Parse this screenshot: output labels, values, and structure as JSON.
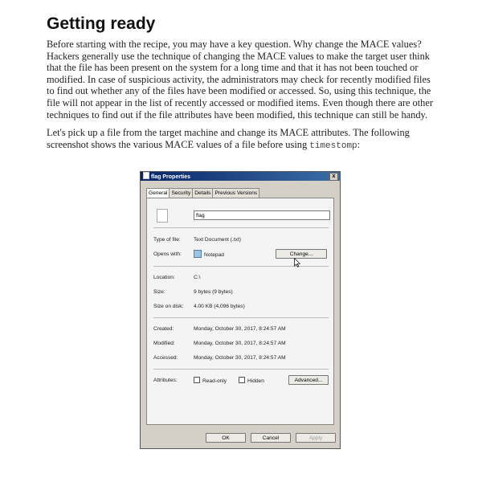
{
  "heading": "Getting ready",
  "paragraph1": "Before starting with the recipe, you may have a key question. Why change the MACE values? Hackers generally use the technique of changing the MACE values to make the target user think that the file has been present on the system for a long time and that it has not been touched or modified. In case of suspicious activity, the administrators may check for recently modified files to find out whether any of the files have been modified or accessed. So, using this technique, the file will not appear in the list of recently accessed or modified items. Even though there are other techniques to find out if the file attributes have been modified, this technique can still be handy.",
  "paragraph2_text": "Let's pick up a file from the target machine and change its MACE attributes. The following screenshot shows the various MACE values of a file before using ",
  "paragraph2_code": "timestomp",
  "paragraph2_end": ":",
  "dialog": {
    "title": "flag Properties",
    "close": "x",
    "tabs": [
      "General",
      "Security",
      "Details",
      "Previous Versions"
    ],
    "file_name": "flag",
    "type_label": "Type of file:",
    "type_value": "Text Document (.txt)",
    "opens_label": "Opens with:",
    "opens_value": "Notepad",
    "change_btn": "Change...",
    "location_label": "Location:",
    "location_value": "C:\\",
    "size_label": "Size:",
    "size_value": "9 bytes (9 bytes)",
    "disk_label": "Size on disk:",
    "disk_value": "4.00 KB (4,096 bytes)",
    "created_label": "Created:",
    "created_value": "Monday, October 30, 2017, 8:24:57 AM",
    "modified_label": "Modified:",
    "modified_value": "Monday, October 30, 2017, 8:24:57 AM",
    "accessed_label": "Accessed:",
    "accessed_value": "Monday, October 30, 2017, 8:24:57 AM",
    "attr_label": "Attributes:",
    "readonly": "Read-only",
    "hidden": "Hidden",
    "advanced_btn": "Advanced...",
    "ok_btn": "OK",
    "cancel_btn": "Cancel",
    "apply_btn": "Apply"
  }
}
